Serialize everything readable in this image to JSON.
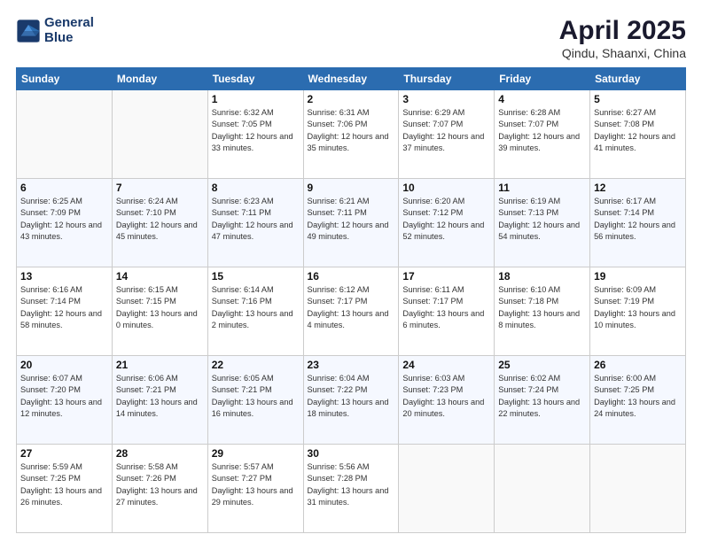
{
  "header": {
    "logo_line1": "General",
    "logo_line2": "Blue",
    "month": "April 2025",
    "location": "Qindu, Shaanxi, China"
  },
  "weekdays": [
    "Sunday",
    "Monday",
    "Tuesday",
    "Wednesday",
    "Thursday",
    "Friday",
    "Saturday"
  ],
  "weeks": [
    [
      {
        "day": "",
        "info": ""
      },
      {
        "day": "",
        "info": ""
      },
      {
        "day": "1",
        "info": "Sunrise: 6:32 AM\nSunset: 7:05 PM\nDaylight: 12 hours and 33 minutes."
      },
      {
        "day": "2",
        "info": "Sunrise: 6:31 AM\nSunset: 7:06 PM\nDaylight: 12 hours and 35 minutes."
      },
      {
        "day": "3",
        "info": "Sunrise: 6:29 AM\nSunset: 7:07 PM\nDaylight: 12 hours and 37 minutes."
      },
      {
        "day": "4",
        "info": "Sunrise: 6:28 AM\nSunset: 7:07 PM\nDaylight: 12 hours and 39 minutes."
      },
      {
        "day": "5",
        "info": "Sunrise: 6:27 AM\nSunset: 7:08 PM\nDaylight: 12 hours and 41 minutes."
      }
    ],
    [
      {
        "day": "6",
        "info": "Sunrise: 6:25 AM\nSunset: 7:09 PM\nDaylight: 12 hours and 43 minutes."
      },
      {
        "day": "7",
        "info": "Sunrise: 6:24 AM\nSunset: 7:10 PM\nDaylight: 12 hours and 45 minutes."
      },
      {
        "day": "8",
        "info": "Sunrise: 6:23 AM\nSunset: 7:11 PM\nDaylight: 12 hours and 47 minutes."
      },
      {
        "day": "9",
        "info": "Sunrise: 6:21 AM\nSunset: 7:11 PM\nDaylight: 12 hours and 49 minutes."
      },
      {
        "day": "10",
        "info": "Sunrise: 6:20 AM\nSunset: 7:12 PM\nDaylight: 12 hours and 52 minutes."
      },
      {
        "day": "11",
        "info": "Sunrise: 6:19 AM\nSunset: 7:13 PM\nDaylight: 12 hours and 54 minutes."
      },
      {
        "day": "12",
        "info": "Sunrise: 6:17 AM\nSunset: 7:14 PM\nDaylight: 12 hours and 56 minutes."
      }
    ],
    [
      {
        "day": "13",
        "info": "Sunrise: 6:16 AM\nSunset: 7:14 PM\nDaylight: 12 hours and 58 minutes."
      },
      {
        "day": "14",
        "info": "Sunrise: 6:15 AM\nSunset: 7:15 PM\nDaylight: 13 hours and 0 minutes."
      },
      {
        "day": "15",
        "info": "Sunrise: 6:14 AM\nSunset: 7:16 PM\nDaylight: 13 hours and 2 minutes."
      },
      {
        "day": "16",
        "info": "Sunrise: 6:12 AM\nSunset: 7:17 PM\nDaylight: 13 hours and 4 minutes."
      },
      {
        "day": "17",
        "info": "Sunrise: 6:11 AM\nSunset: 7:17 PM\nDaylight: 13 hours and 6 minutes."
      },
      {
        "day": "18",
        "info": "Sunrise: 6:10 AM\nSunset: 7:18 PM\nDaylight: 13 hours and 8 minutes."
      },
      {
        "day": "19",
        "info": "Sunrise: 6:09 AM\nSunset: 7:19 PM\nDaylight: 13 hours and 10 minutes."
      }
    ],
    [
      {
        "day": "20",
        "info": "Sunrise: 6:07 AM\nSunset: 7:20 PM\nDaylight: 13 hours and 12 minutes."
      },
      {
        "day": "21",
        "info": "Sunrise: 6:06 AM\nSunset: 7:21 PM\nDaylight: 13 hours and 14 minutes."
      },
      {
        "day": "22",
        "info": "Sunrise: 6:05 AM\nSunset: 7:21 PM\nDaylight: 13 hours and 16 minutes."
      },
      {
        "day": "23",
        "info": "Sunrise: 6:04 AM\nSunset: 7:22 PM\nDaylight: 13 hours and 18 minutes."
      },
      {
        "day": "24",
        "info": "Sunrise: 6:03 AM\nSunset: 7:23 PM\nDaylight: 13 hours and 20 minutes."
      },
      {
        "day": "25",
        "info": "Sunrise: 6:02 AM\nSunset: 7:24 PM\nDaylight: 13 hours and 22 minutes."
      },
      {
        "day": "26",
        "info": "Sunrise: 6:00 AM\nSunset: 7:25 PM\nDaylight: 13 hours and 24 minutes."
      }
    ],
    [
      {
        "day": "27",
        "info": "Sunrise: 5:59 AM\nSunset: 7:25 PM\nDaylight: 13 hours and 26 minutes."
      },
      {
        "day": "28",
        "info": "Sunrise: 5:58 AM\nSunset: 7:26 PM\nDaylight: 13 hours and 27 minutes."
      },
      {
        "day": "29",
        "info": "Sunrise: 5:57 AM\nSunset: 7:27 PM\nDaylight: 13 hours and 29 minutes."
      },
      {
        "day": "30",
        "info": "Sunrise: 5:56 AM\nSunset: 7:28 PM\nDaylight: 13 hours and 31 minutes."
      },
      {
        "day": "",
        "info": ""
      },
      {
        "day": "",
        "info": ""
      },
      {
        "day": "",
        "info": ""
      }
    ]
  ]
}
